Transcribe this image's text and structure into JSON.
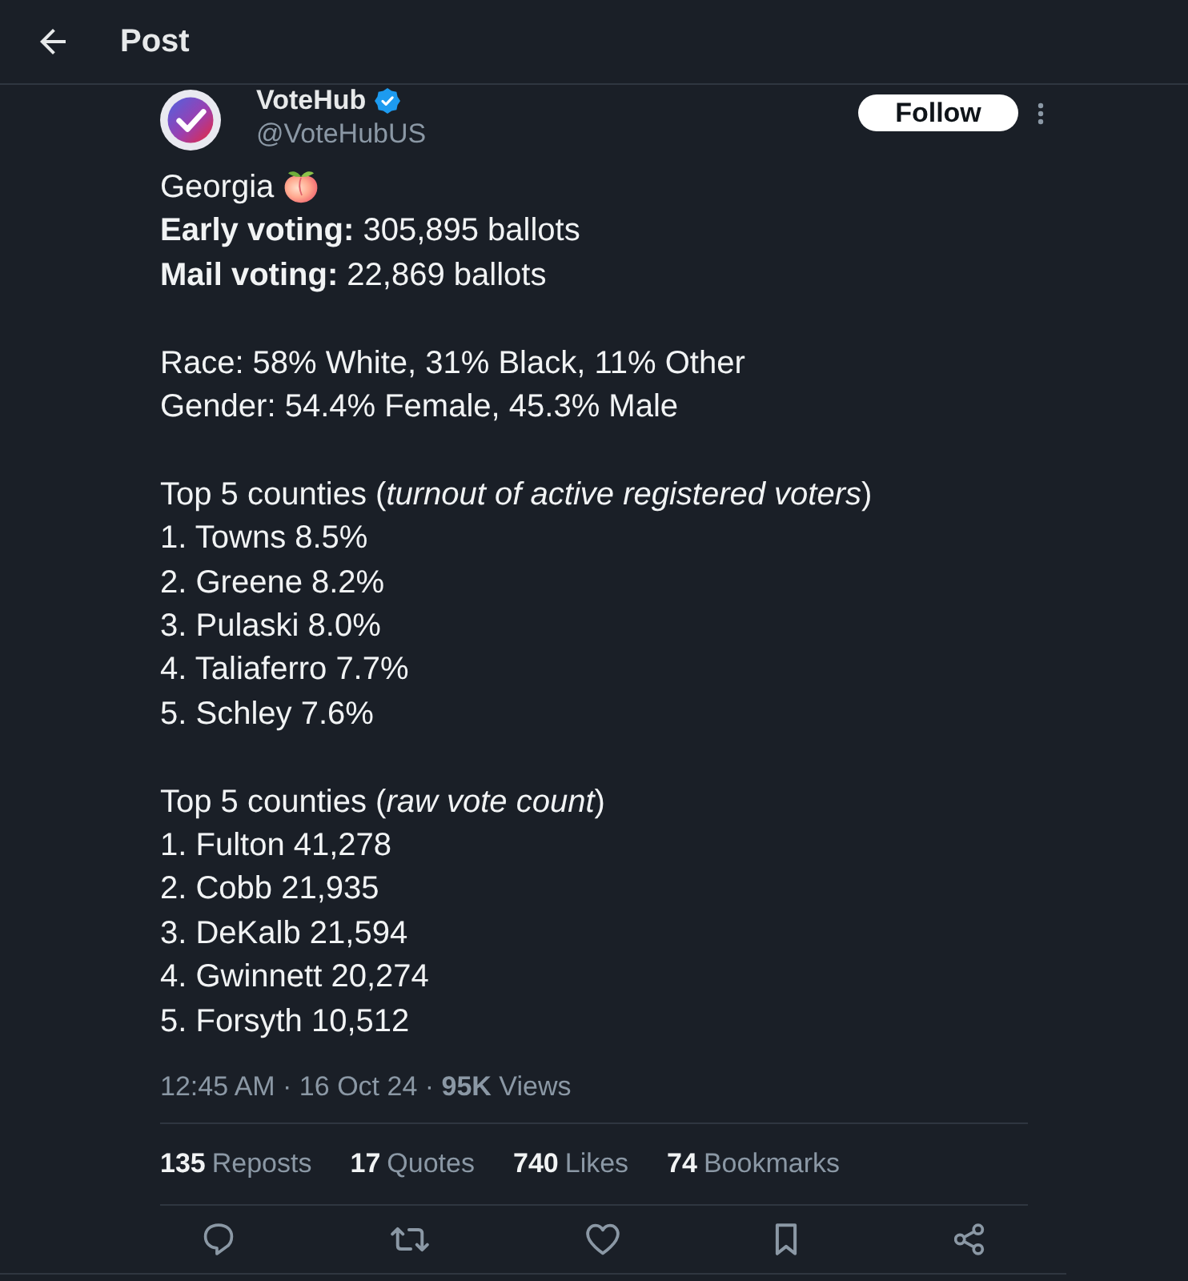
{
  "header": {
    "title": "Post"
  },
  "post": {
    "author": {
      "name": "VoteHub",
      "verified": true,
      "handle": "@VoteHubUS"
    },
    "follow_button": "Follow",
    "title": "Georgia",
    "paragraphs": [
      [
        "**Early voting:** 305,895 ballots",
        "**Mail voting:** 22,869 ballots"
      ],
      [
        "Race: 58% White, 31% Black, 11% Other",
        "Gender: 54.4% Female, 45.3% Male"
      ],
      [
        "Top 5 counties (*turnout of active registered voters*)",
        "1. Towns 8.5%",
        "2. Greene 8.2%",
        "3. Pulaski 8.0%",
        "4. Taliaferro 7.7%",
        "5. Schley 7.6%"
      ],
      [
        "Top 5 counties (*raw vote count*)",
        "1. Fulton 41,278",
        "2. Cobb 21,935",
        "3. DeKalb 21,594",
        "4. Gwinnett 20,274",
        "5. Forsyth 10,512"
      ]
    ],
    "meta": "12:45 AM · 16 Oct 24 · **95K** Views",
    "stats": [
      {
        "count": "135",
        "label": "Reposts"
      },
      {
        "count": "17",
        "label": "Quotes"
      },
      {
        "count": "740",
        "label": "Likes"
      },
      {
        "count": "74",
        "label": "Bookmarks"
      }
    ]
  }
}
